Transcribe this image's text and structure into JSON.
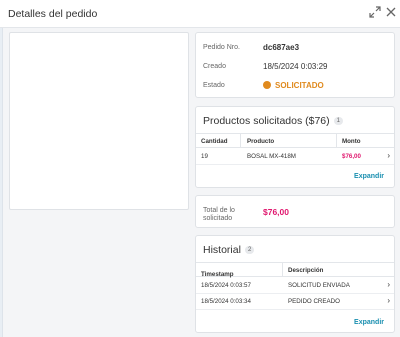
{
  "header": {
    "title": "Detalles del pedido",
    "expand_icon": "expand-icon",
    "close_icon": "close-icon"
  },
  "info": {
    "order_label": "Pedido Nro.",
    "order_value": "dc687ae3",
    "created_label": "Creado",
    "created_value": "18/5/2024 0:03:29",
    "status_label": "Estado",
    "status_value": "SOLICITADO",
    "status_color": "#e08a1e"
  },
  "products": {
    "title": "Productos solicitados ($76)",
    "count": "1",
    "columns": [
      "Cantidad",
      "Producto",
      "Monto"
    ],
    "rows": [
      {
        "qty": "19",
        "product": "BOSAL MX-418M",
        "amount": "$76,00"
      }
    ],
    "expand_label": "Expandir"
  },
  "total": {
    "label": "Total de lo solicitado",
    "value": "$76,00"
  },
  "history": {
    "title": "Historial",
    "count": "2",
    "columns": [
      "Timestamp",
      "Descripción"
    ],
    "sort_icon": "arrow-down-icon",
    "rows": [
      {
        "timestamp": "18/5/2024 0:03:57",
        "description": "SOLICITUD ENVIADA"
      },
      {
        "timestamp": "18/5/2024 0:03:34",
        "description": "PEDIDO CREADO"
      }
    ],
    "expand_label": "Expandir"
  },
  "colors": {
    "accent": "#1a8fb0",
    "amount": "#e0176e",
    "status": "#e08a1e"
  }
}
